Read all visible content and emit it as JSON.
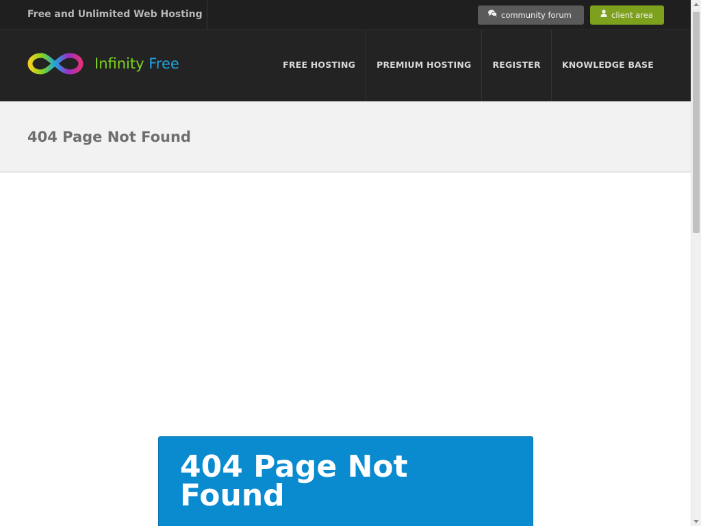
{
  "topbar": {
    "tagline": "Free and Unlimited Web Hosting",
    "forum_button": {
      "label": "community forum",
      "icon": "comments-icon"
    },
    "client_button": {
      "label": "client area",
      "icon": "user-icon"
    }
  },
  "brand": {
    "name_part1": "Infinity",
    "name_part2": "Free",
    "colors": {
      "part1": "#7ed321",
      "part2": "#1fa4e0"
    }
  },
  "nav": {
    "items": [
      {
        "label": "FREE HOSTING"
      },
      {
        "label": "PREMIUM HOSTING"
      },
      {
        "label": "REGISTER"
      },
      {
        "label": "KNOWLEDGE BASE"
      }
    ]
  },
  "page": {
    "title": "404 Page Not Found",
    "card_heading": "404 Page Not Found"
  },
  "colors": {
    "topbar_bg": "#1f1f1f",
    "header_bg": "#232323",
    "forum_button": "#5a5a5a",
    "client_button": "#7ea11d",
    "card_bg": "#0a8bd0"
  }
}
